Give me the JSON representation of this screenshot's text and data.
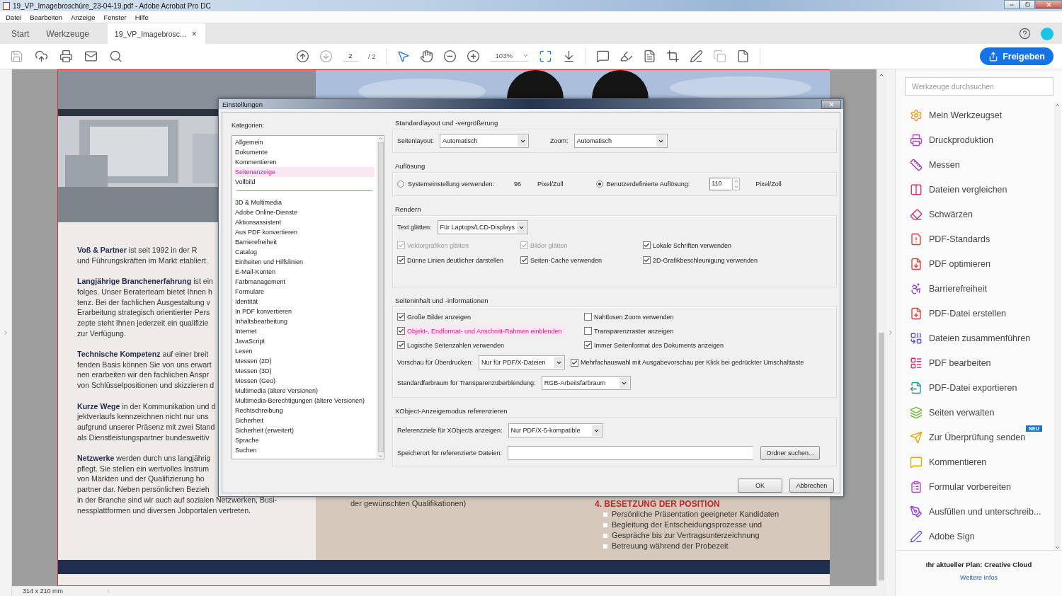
{
  "window": {
    "title": "19_VP_Imagebroschüre_23-04-19.pdf - Adobe Acrobat Pro DC"
  },
  "menu": [
    "Datei",
    "Bearbeiten",
    "Anzeige",
    "Fenster",
    "Hilfe"
  ],
  "tabs": [
    {
      "label": "Start",
      "selected": false
    },
    {
      "label": "Werkzeuge",
      "selected": false
    },
    {
      "label": "19_VP_Imagebrosc...",
      "selected": true,
      "close": "×"
    }
  ],
  "toolbar": {
    "page": "2",
    "page_total": "/ 2",
    "zoom": "103%",
    "share_button": "Freigeben"
  },
  "document": {
    "paragraphs": [
      {
        "lines": [
          "**Voß & Partner** ist seit 1992 in der R",
          "und Führungskräften im Markt etabliert."
        ]
      },
      {
        "lines": [
          "**Langjährige Branchenerfahrung** ist ein",
          "folges. Unser Beraterteam bietet Ihnen h",
          "tenz. Bei der fachlichen Ausgestaltung v",
          "Erarbeitung strategisch orientierter Pers",
          "zepte steht Ihnen jederzeit ein qualifizie",
          "zur Verfügung."
        ]
      },
      {
        "lines": [
          "**Technische Kompetenz** auf einer breit",
          "fenden Basis können Sie von uns erwart",
          "nen erarbeiten wir den fachlichen Anspr",
          "von Schlüsselpositionen und skizzieren d"
        ]
      },
      {
        "lines": [
          "**Kurze Wege** in der Kommunikation und d",
          "jektverlaufs kennzeichnen nicht nur uns",
          "aufgrund unserer Präsenz mit zwei Stand",
          "als Dienstleistungspartner bundesweit/v"
        ]
      },
      {
        "lines": [
          "**Netzwerke** werden durch uns langjährig",
          "pflegt. Sie stellen ein wertvolles Instrum",
          "von Märkten und der Qualifizierung ho",
          "partner dar. Neben persönlichen Bezieh"
        ]
      },
      {
        "lines": [
          "in der Branche sind wir auch auf sozialen Netzwerken, Busi-",
          "nessplattformen und diversen Jobportalen vertreten."
        ],
        "continued": true
      }
    ],
    "right_text": "der gewünschten Qualifikationen)",
    "heading": "4. BESETZUNG DER POSITION",
    "bullets": [
      "Persönliche Präsentation geeigneter Kandidaten",
      "Begleitung der Entscheidungsprozesse und",
      "Gespräche bis zur Vertragsunterzeichnung",
      "Betreuung während der Probezeit"
    ]
  },
  "dialog": {
    "title": "Einstellungen",
    "categories_label": "Kategorien:",
    "category_groups": [
      {
        "items": [
          {
            "label": "Allgemein",
            "selected": false
          },
          {
            "label": "Dokumente",
            "selected": false
          },
          {
            "label": "Kommentieren",
            "selected": false
          },
          {
            "label": "Seitenanzeige",
            "selected": true
          },
          {
            "label": "Vollbild",
            "selected": false
          }
        ]
      },
      {
        "items": [
          {
            "label": "3D & Multimedia",
            "selected": false
          },
          {
            "label": "Adobe Online-Dienste",
            "selected": false
          },
          {
            "label": "Aktionsassistent",
            "selected": false
          },
          {
            "label": "Aus PDF konvertieren",
            "selected": false
          },
          {
            "label": "Barrierefreiheit",
            "selected": false
          },
          {
            "label": "Catalog",
            "selected": false
          },
          {
            "label": "Einheiten und Hilfslinien",
            "selected": false
          },
          {
            "label": "E-Mail-Konten",
            "selected": false
          },
          {
            "label": "Farbmanagement",
            "selected": false
          },
          {
            "label": "Formulare",
            "selected": false
          },
          {
            "label": "Identität",
            "selected": false
          },
          {
            "label": "In PDF konvertieren",
            "selected": false
          },
          {
            "label": "Inhaltsbearbeitung",
            "selected": false
          },
          {
            "label": "Internet",
            "selected": false
          },
          {
            "label": "JavaScript",
            "selected": false
          },
          {
            "label": "Lesen",
            "selected": false
          },
          {
            "label": "Messen (2D)",
            "selected": false
          },
          {
            "label": "Messen (3D)",
            "selected": false
          },
          {
            "label": "Messen (Geo)",
            "selected": false
          },
          {
            "label": "Multimedia (ältere Versionen)",
            "selected": false
          },
          {
            "label": "Multimedia-Berechtigungen (ältere Versionen)",
            "selected": false
          },
          {
            "label": "Rechtschreibung",
            "selected": false
          },
          {
            "label": "Sicherheit",
            "selected": false
          },
          {
            "label": "Sicherheit (erweitert)",
            "selected": false
          },
          {
            "label": "Sprache",
            "selected": false
          },
          {
            "label": "Suchen",
            "selected": false
          }
        ]
      }
    ],
    "layout": {
      "title": "Standardlayout und -vergrößerung",
      "page_layout_label": "Seitenlayout:",
      "page_layout": "Automatisch",
      "zoom_label": "Zoom:",
      "zoom": "Automatisch"
    },
    "resolution": {
      "title": "Auflösung",
      "options": [
        {
          "label": "Systemeinstellung verwenden:",
          "selected": false,
          "value": "96",
          "unit": "Pixel/Zoll"
        },
        {
          "label": "Benutzerdefinierte Auflösung:",
          "selected": true,
          "value": "110",
          "unit": "Pixel/Zoll"
        }
      ]
    },
    "render": {
      "title": "Rendern",
      "smooth_label": "Text glätten:",
      "smooth": "Für Laptops/LCD-Displays",
      "checkboxes": [
        {
          "label": "Vektorgrafiken glätten",
          "checked": true,
          "disabled": true
        },
        {
          "label": "Bilder glätten",
          "checked": true,
          "disabled": true
        },
        {
          "label": "Lokale Schriften verwenden",
          "checked": true,
          "disabled": false
        },
        {
          "label": "Dünne Linien deutlicher darstellen",
          "checked": true,
          "disabled": false
        },
        {
          "label": "Seiten-Cache verwenden",
          "checked": true,
          "disabled": false
        },
        {
          "label": "2D-Grafikbeschleunigung verwenden",
          "checked": true,
          "disabled": false
        }
      ]
    },
    "content": {
      "title": "Seiteninhalt und -informationen",
      "checkboxes": [
        {
          "label": "Große Bilder anzeigen",
          "checked": true,
          "highlighted": false
        },
        {
          "label": "Nahtlosen Zoom verwenden",
          "checked": false,
          "highlighted": false
        },
        {
          "label": "Objekt-, Endformat- und Anschnitt-Rahmen einblenden",
          "checked": true,
          "highlighted": true
        },
        {
          "label": "Transparenzraster anzeigen",
          "checked": false,
          "highlighted": false
        },
        {
          "label": "Logische Seitenzahlen verwenden",
          "checked": true,
          "highlighted": false
        },
        {
          "label": "Immer Seitenformat des Dokuments anzeigen",
          "checked": true,
          "highlighted": false
        }
      ],
      "overprint_label": "Vorschau für Überdrucken:",
      "overprint": "Nur für PDF/X-Dateien",
      "multi_select": {
        "label": "Mehrfachauswahl mit Ausgabevorschau per Klick bei gedrückter Umschalttaste",
        "checked": true
      },
      "blend_label": "Standardfarbraum für Transparenzüberblendung:",
      "blend": "RGB-Arbeitsfarbraum"
    },
    "xobject": {
      "title": "XObject-Anzeigemodus referenzieren",
      "targets_label": "Referenzziele für XObjects anzeigen:",
      "targets": "Nur PDF/X-5-kompatible",
      "location_label": "Speicherort für referenzierte Dateien:",
      "browse_button": "Ordner suchen..."
    },
    "buttons": [
      "OK",
      "Abbrechen"
    ]
  },
  "tools_panel": {
    "search_placeholder": "Werkzeuge durchsuchen",
    "tools": [
      {
        "label": "Mein Werkzeugset"
      },
      {
        "label": "Druckproduktion"
      },
      {
        "label": "Messen"
      },
      {
        "label": "Dateien vergleichen"
      },
      {
        "label": "Schwärzen"
      },
      {
        "label": "PDF-Standards"
      },
      {
        "label": "PDF optimieren"
      },
      {
        "label": "Barrierefreiheit"
      },
      {
        "label": "PDF-Datei erstellen"
      },
      {
        "label": "Dateien zusammenführen"
      },
      {
        "label": "PDF bearbeiten"
      },
      {
        "label": "PDF-Datei exportieren"
      },
      {
        "label": "Seiten verwalten"
      },
      {
        "label": "Zur Überprüfung senden",
        "badge": "NEU"
      },
      {
        "label": "Kommentieren"
      },
      {
        "label": "Formular vorbereiten"
      },
      {
        "label": "Ausfüllen und unterschreib..."
      },
      {
        "label": "Adobe Sign"
      }
    ],
    "plan": "Ihr aktueller Plan: Creative Cloud",
    "more_link": "Weitere Infos"
  },
  "status_bar": {
    "page_size": "314 x 210 mm"
  }
}
